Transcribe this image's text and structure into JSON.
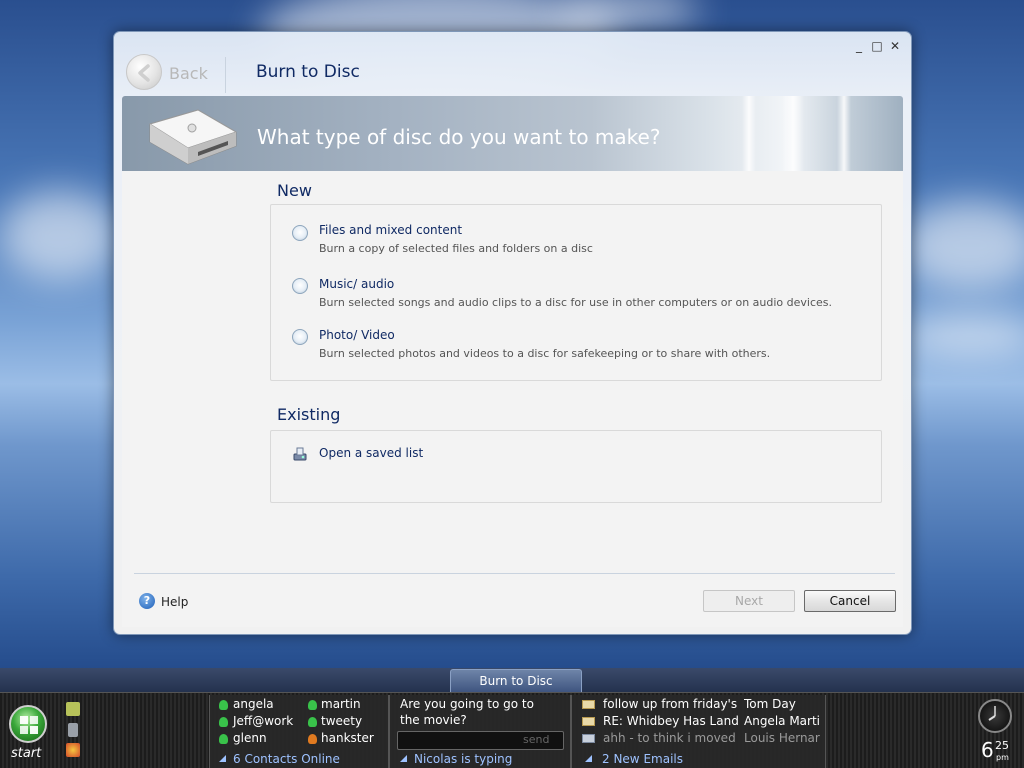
{
  "window": {
    "back_label": "Back",
    "title": "Burn to Disc",
    "controls": [
      "_",
      "□",
      "✕"
    ],
    "banner_question": "What type of disc do you want to make?"
  },
  "new_section": {
    "heading": "New",
    "options": [
      {
        "title": "Files and mixed content",
        "desc": "Burn a copy of selected files and folders on a disc"
      },
      {
        "title": "Music/ audio",
        "desc": "Burn selected songs and audio clips to a disc for use in other computers or on audio devices."
      },
      {
        "title": "Photo/ Video",
        "desc": "Burn selected photos and videos to a disc for safekeeping or to share with others."
      }
    ]
  },
  "existing_section": {
    "heading": "Existing",
    "open_saved": "Open a saved list"
  },
  "footer": {
    "help_label": "Help",
    "next_label": "Next",
    "cancel_label": "Cancel"
  },
  "taskbar": {
    "active_task": "Burn to Disc",
    "start_label": "start",
    "contacts": [
      {
        "name": "angela",
        "status": "online"
      },
      {
        "name": "Jeff@work",
        "status": "online"
      },
      {
        "name": "glenn",
        "status": "online"
      },
      {
        "name": "martin",
        "status": "online"
      },
      {
        "name": "tweety",
        "status": "online"
      },
      {
        "name": "hankster",
        "status": "away"
      }
    ],
    "contacts_footer": "6 Contacts Online",
    "message_line1": "Are you going to go to",
    "message_line2": "the movie?",
    "send_label": "send",
    "typing_footer": "Nicolas is typing",
    "emails": [
      {
        "subject": "follow up from friday's",
        "sender": "Tom Day"
      },
      {
        "subject": "RE: Whidbey Has Land",
        "sender": "Angela Marti"
      },
      {
        "subject": "ahh - to think i moved",
        "sender": "Louis Hernar"
      }
    ],
    "emails_footer": "2 New Emails",
    "clock_hour": "6",
    "clock_minutes": "25",
    "clock_ampm": "pm"
  },
  "colors": {
    "title_blue": "#102a64",
    "online_green": "#39c24a",
    "away_orange": "#e07a20",
    "link_blue": "#9ec2ff"
  }
}
